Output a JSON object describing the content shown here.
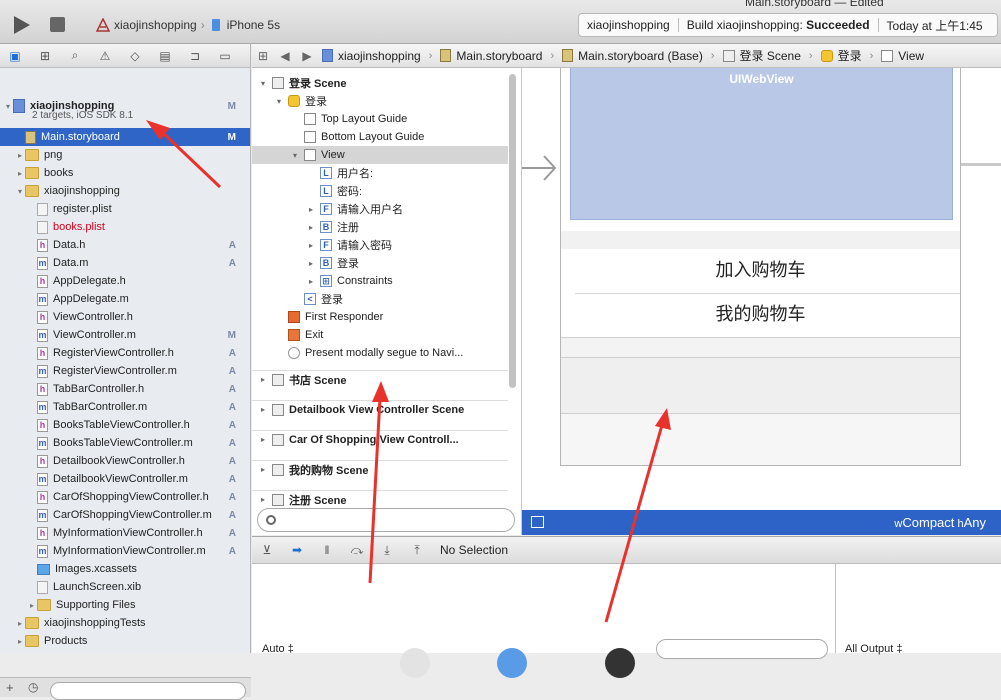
{
  "window": {
    "title": "Main.storyboard — Edited",
    "scheme_target": "xiaojinshopping",
    "scheme_device": "iPhone 5s"
  },
  "status": {
    "project": "xiaojinshopping",
    "build_prefix": "Build xiaojinshopping: ",
    "build_result": "Succeeded",
    "time": "Today at 上午1:45"
  },
  "jumpbar": {
    "items": [
      "xiaojinshopping",
      "Main.storyboard",
      "Main.storyboard (Base)",
      "登录 Scene",
      "登录",
      "View"
    ]
  },
  "navigator": {
    "rows": [
      {
        "name": "xiaojinshopping",
        "badge": "M",
        "kind": "proj",
        "indent": 0,
        "disc": "▾",
        "bold": true
      },
      {
        "name": "2 targets, iOS SDK 8.1",
        "badge": "",
        "kind": "sub",
        "indent": 0,
        "disc": ""
      },
      {
        "name": "Main.storyboard",
        "badge": "M",
        "kind": "story",
        "indent": 1,
        "disc": "",
        "selected": true
      },
      {
        "name": "png",
        "badge": "",
        "kind": "folder",
        "indent": 1,
        "disc": "▸"
      },
      {
        "name": "books",
        "badge": "",
        "kind": "folder",
        "indent": 1,
        "disc": "▸"
      },
      {
        "name": "xiaojinshopping",
        "badge": "",
        "kind": "folder",
        "indent": 1,
        "disc": "▾"
      },
      {
        "name": "register.plist",
        "badge": "",
        "kind": "plist",
        "indent": 2,
        "disc": ""
      },
      {
        "name": "books.plist",
        "badge": "",
        "kind": "plist",
        "indent": 2,
        "disc": "",
        "red": true
      },
      {
        "name": "Data.h",
        "badge": "A",
        "kind": "h",
        "indent": 2,
        "disc": ""
      },
      {
        "name": "Data.m",
        "badge": "A",
        "kind": "m",
        "indent": 2,
        "disc": ""
      },
      {
        "name": "AppDelegate.h",
        "badge": "",
        "kind": "h",
        "indent": 2,
        "disc": ""
      },
      {
        "name": "AppDelegate.m",
        "badge": "",
        "kind": "m",
        "indent": 2,
        "disc": ""
      },
      {
        "name": "ViewController.h",
        "badge": "",
        "kind": "h",
        "indent": 2,
        "disc": ""
      },
      {
        "name": "ViewController.m",
        "badge": "M",
        "kind": "m",
        "indent": 2,
        "disc": ""
      },
      {
        "name": "RegisterViewController.h",
        "badge": "A",
        "kind": "h",
        "indent": 2,
        "disc": ""
      },
      {
        "name": "RegisterViewController.m",
        "badge": "A",
        "kind": "m",
        "indent": 2,
        "disc": ""
      },
      {
        "name": "TabBarController.h",
        "badge": "A",
        "kind": "h",
        "indent": 2,
        "disc": ""
      },
      {
        "name": "TabBarController.m",
        "badge": "A",
        "kind": "m",
        "indent": 2,
        "disc": ""
      },
      {
        "name": "BooksTableViewController.h",
        "badge": "A",
        "kind": "h",
        "indent": 2,
        "disc": ""
      },
      {
        "name": "BooksTableViewController.m",
        "badge": "A",
        "kind": "m",
        "indent": 2,
        "disc": ""
      },
      {
        "name": "DetailbookViewController.h",
        "badge": "A",
        "kind": "h",
        "indent": 2,
        "disc": ""
      },
      {
        "name": "DetailbookViewController.m",
        "badge": "A",
        "kind": "m",
        "indent": 2,
        "disc": ""
      },
      {
        "name": "CarOfShoppingViewController.h",
        "badge": "A",
        "kind": "h",
        "indent": 2,
        "disc": ""
      },
      {
        "name": "CarOfShoppingViewController.m",
        "badge": "A",
        "kind": "m",
        "indent": 2,
        "disc": ""
      },
      {
        "name": "MyInformationViewController.h",
        "badge": "A",
        "kind": "h",
        "indent": 2,
        "disc": ""
      },
      {
        "name": "MyInformationViewController.m",
        "badge": "A",
        "kind": "m",
        "indent": 2,
        "disc": ""
      },
      {
        "name": "Images.xcassets",
        "badge": "",
        "kind": "xcassets",
        "indent": 2,
        "disc": ""
      },
      {
        "name": "LaunchScreen.xib",
        "badge": "",
        "kind": "plist",
        "indent": 2,
        "disc": ""
      },
      {
        "name": "Supporting Files",
        "badge": "",
        "kind": "folder",
        "indent": 2,
        "disc": "▸"
      },
      {
        "name": "xiaojinshoppingTests",
        "badge": "",
        "kind": "folder",
        "indent": 1,
        "disc": "▸"
      },
      {
        "name": "Products",
        "badge": "",
        "kind": "folder",
        "indent": 1,
        "disc": "▸"
      }
    ]
  },
  "outline": {
    "rows": [
      {
        "label": "登录 Scene",
        "indent": 0,
        "tri": "▾",
        "icon": "scene-ic",
        "glyph": "",
        "scene": true
      },
      {
        "label": "登录",
        "indent": 1,
        "tri": "▾",
        "icon": "vc",
        "glyph": ""
      },
      {
        "label": "Top Layout Guide",
        "indent": 2,
        "tri": "",
        "icon": "view",
        "glyph": ""
      },
      {
        "label": "Bottom Layout Guide",
        "indent": 2,
        "tri": "",
        "icon": "view",
        "glyph": ""
      },
      {
        "label": "View",
        "indent": 2,
        "tri": "▾",
        "icon": "view",
        "glyph": "",
        "selected": true
      },
      {
        "label": "用户名:",
        "indent": 3,
        "tri": "",
        "icon": "lbl",
        "glyph": "L"
      },
      {
        "label": "密码:",
        "indent": 3,
        "tri": "",
        "icon": "lbl",
        "glyph": "L"
      },
      {
        "label": "请输入用户名",
        "indent": 3,
        "tri": "▸",
        "icon": "lbl",
        "glyph": "F"
      },
      {
        "label": "注册",
        "indent": 3,
        "tri": "▸",
        "icon": "lbl",
        "glyph": "B"
      },
      {
        "label": "请输入密码",
        "indent": 3,
        "tri": "▸",
        "icon": "lbl",
        "glyph": "F"
      },
      {
        "label": "登录",
        "indent": 3,
        "tri": "▸",
        "icon": "lbl",
        "glyph": "B"
      },
      {
        "label": "Constraints",
        "indent": 3,
        "tri": "▸",
        "icon": "lbl",
        "glyph": "⊞"
      },
      {
        "label": "登录",
        "indent": 2,
        "tri": "",
        "icon": "lbl",
        "glyph": "<"
      },
      {
        "label": "First Responder",
        "indent": 1,
        "tri": "",
        "icon": "fr",
        "glyph": ""
      },
      {
        "label": "Exit",
        "indent": 1,
        "tri": "",
        "icon": "exit",
        "glyph": ""
      },
      {
        "label": "Present modally segue to Navi...",
        "indent": 1,
        "tri": "",
        "icon": "seg",
        "glyph": ""
      },
      {
        "label": "书店 Scene",
        "indent": 0,
        "tri": "▸",
        "icon": "scene-ic",
        "glyph": "",
        "scene": true,
        "divider": true,
        "gap": 8
      },
      {
        "label": "Detailbook View Controller Scene",
        "indent": 0,
        "tri": "▸",
        "icon": "scene-ic",
        "glyph": "",
        "scene": true,
        "divider": true,
        "gap": 12
      },
      {
        "label": "Car Of Shopping View Controll...",
        "indent": 0,
        "tri": "▸",
        "icon": "scene-ic",
        "glyph": "",
        "scene": true,
        "divider": true,
        "gap": 12
      },
      {
        "label": "我的购物 Scene",
        "indent": 0,
        "tri": "▸",
        "icon": "scene-ic",
        "glyph": "",
        "scene": true,
        "divider": true,
        "gap": 12
      },
      {
        "label": "注册 Scene",
        "indent": 0,
        "tri": "▸",
        "icon": "scene-ic",
        "glyph": "",
        "scene": true,
        "divider": true,
        "gap": 12
      }
    ]
  },
  "canvas": {
    "webview_label": "UIWebView",
    "cell_add_cart": "加入购物车",
    "cell_my_cart": "我的购物车"
  },
  "sizeclass": {
    "w_prefix": "w",
    "w_value": "Compact",
    "h_prefix": " h",
    "h_value": "Any"
  },
  "debug": {
    "no_selection": "No Selection",
    "auto": "Auto ‡",
    "all_output": "All Output ‡"
  },
  "colors": {
    "accent": "#2f65c6",
    "annotation": "#e8322b"
  }
}
